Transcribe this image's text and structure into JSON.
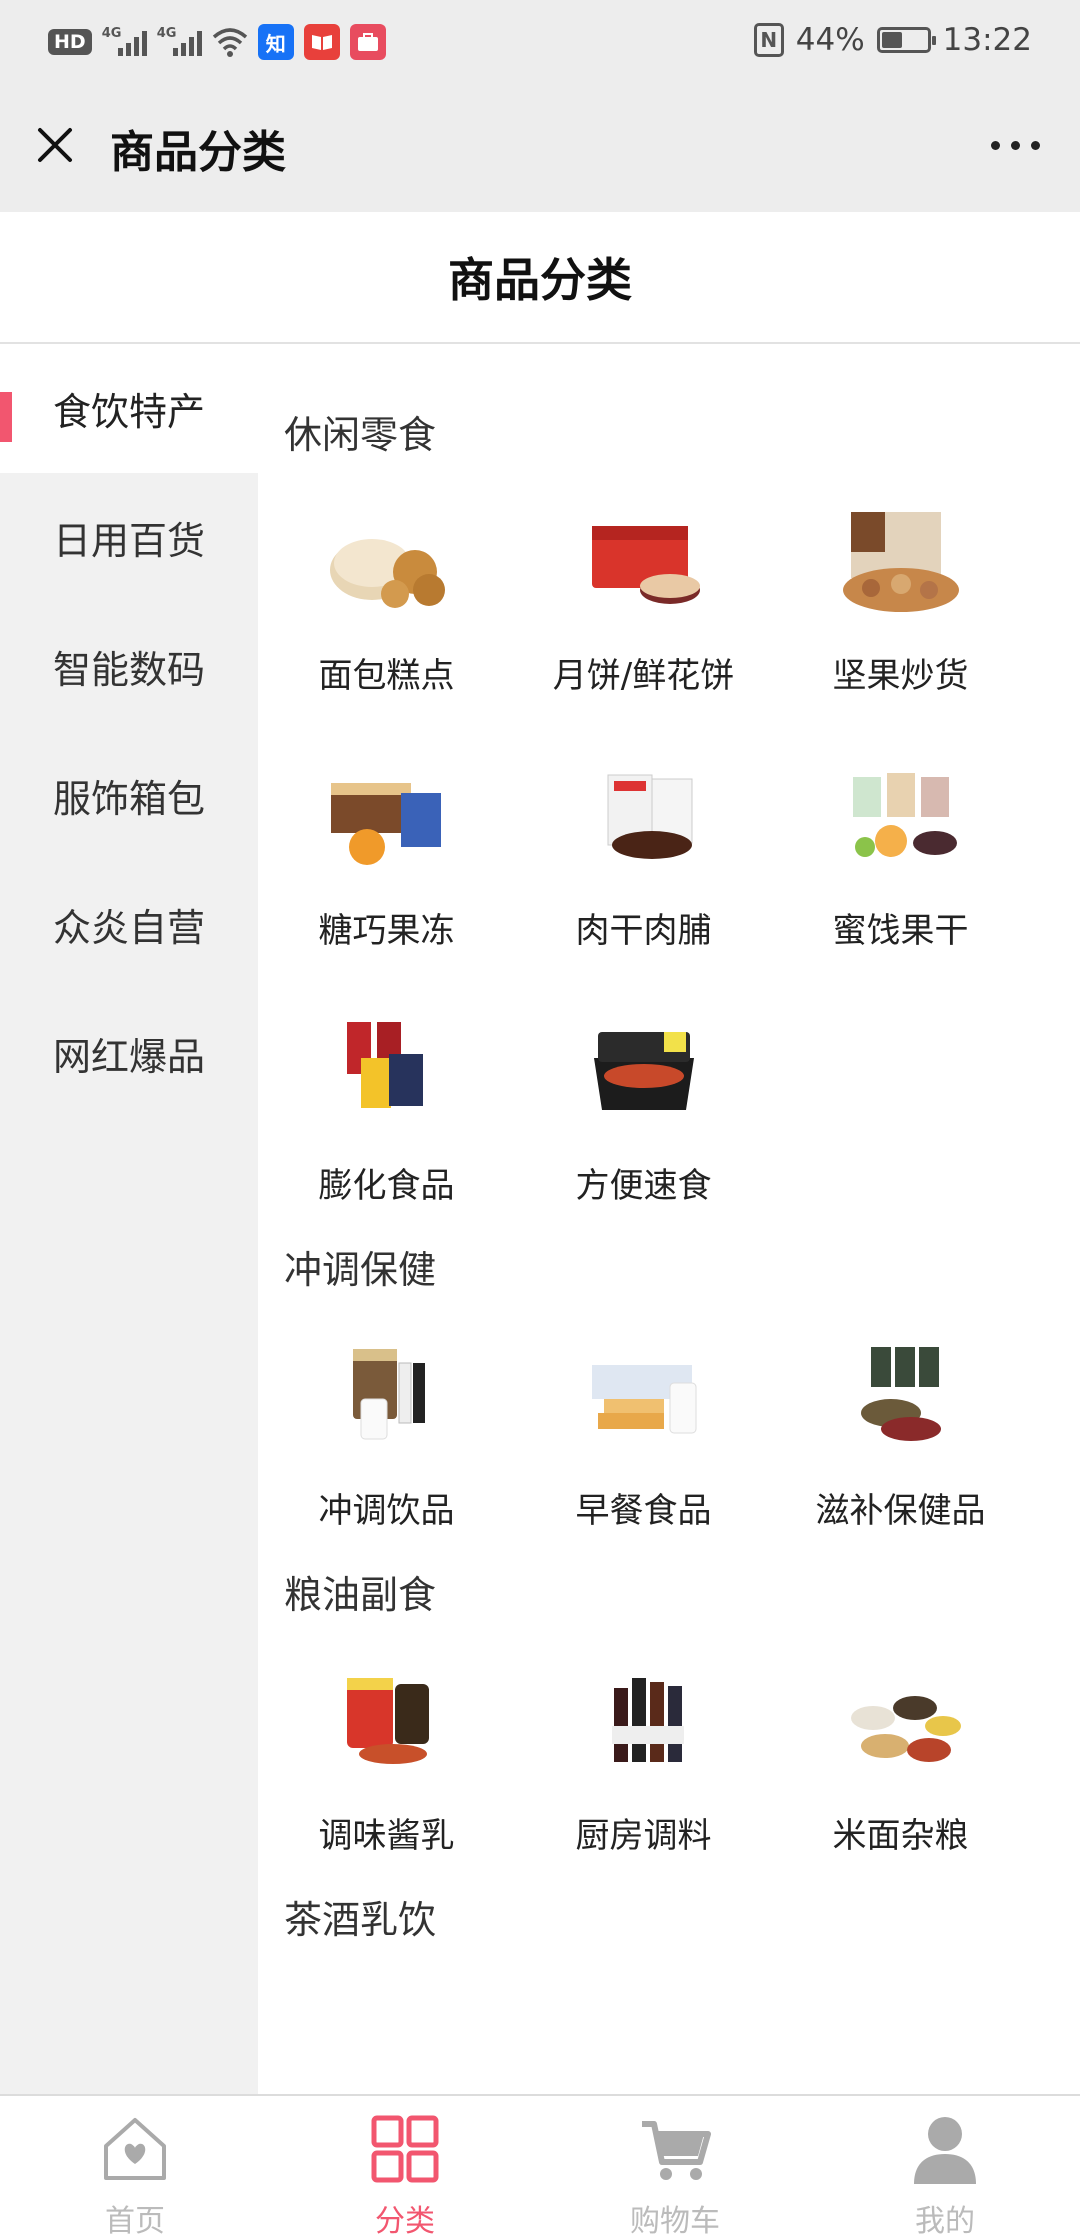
{
  "status_bar": {
    "hd_label": "HD",
    "network_labels": [
      "4G",
      "4G"
    ],
    "app_badges": [
      {
        "name": "zhihu",
        "text": "知",
        "color": "#1772f6"
      },
      {
        "name": "reader",
        "text": "📖",
        "color": "#e8403b"
      },
      {
        "name": "bag",
        "text": "👜",
        "color": "#e84c5f"
      }
    ],
    "nfc_label": "N",
    "battery_percent": "44%",
    "battery_level": 0.44,
    "time": "13:22"
  },
  "wx_header": {
    "title": "商品分类"
  },
  "page": {
    "title": "商品分类"
  },
  "sidebar": {
    "active_index": 0,
    "items": [
      "食饮特产",
      "日用百货",
      "智能数码",
      "服饰箱包",
      "众炎自营",
      "网红爆品"
    ]
  },
  "sections": [
    {
      "title": "休闲零食",
      "items": [
        {
          "label": "面包糕点",
          "icon": "bread-icon"
        },
        {
          "label": "月饼/鲜花饼",
          "icon": "mooncake-box-icon"
        },
        {
          "label": "坚果炒货",
          "icon": "nuts-icon"
        },
        {
          "label": "糖巧果冻",
          "icon": "candy-icon"
        },
        {
          "label": "肉干肉脯",
          "icon": "jerky-icon"
        },
        {
          "label": "蜜饯果干",
          "icon": "dried-fruit-icon"
        },
        {
          "label": "膨化食品",
          "icon": "chips-icon"
        },
        {
          "label": "方便速食",
          "icon": "instant-food-icon"
        }
      ]
    },
    {
      "title": "冲调保健",
      "items": [
        {
          "label": "冲调饮品",
          "icon": "powder-drink-icon"
        },
        {
          "label": "早餐食品",
          "icon": "breakfast-icon"
        },
        {
          "label": "滋补保健品",
          "icon": "health-supplement-icon"
        }
      ]
    },
    {
      "title": "粮油副食",
      "items": [
        {
          "label": "调味酱乳",
          "icon": "sauce-jar-icon"
        },
        {
          "label": "厨房调料",
          "icon": "seasoning-bottles-icon"
        },
        {
          "label": "米面杂粮",
          "icon": "grains-icon"
        }
      ]
    },
    {
      "title": "茶酒乳饮",
      "items": []
    }
  ],
  "tabbar": {
    "active_index": 1,
    "accent_color": "#f2566f",
    "tabs": [
      {
        "label": "首页",
        "icon": "home-heart-icon"
      },
      {
        "label": "分类",
        "icon": "category-grid-icon"
      },
      {
        "label": "购物车",
        "icon": "cart-icon"
      },
      {
        "label": "我的",
        "icon": "user-icon"
      }
    ]
  }
}
